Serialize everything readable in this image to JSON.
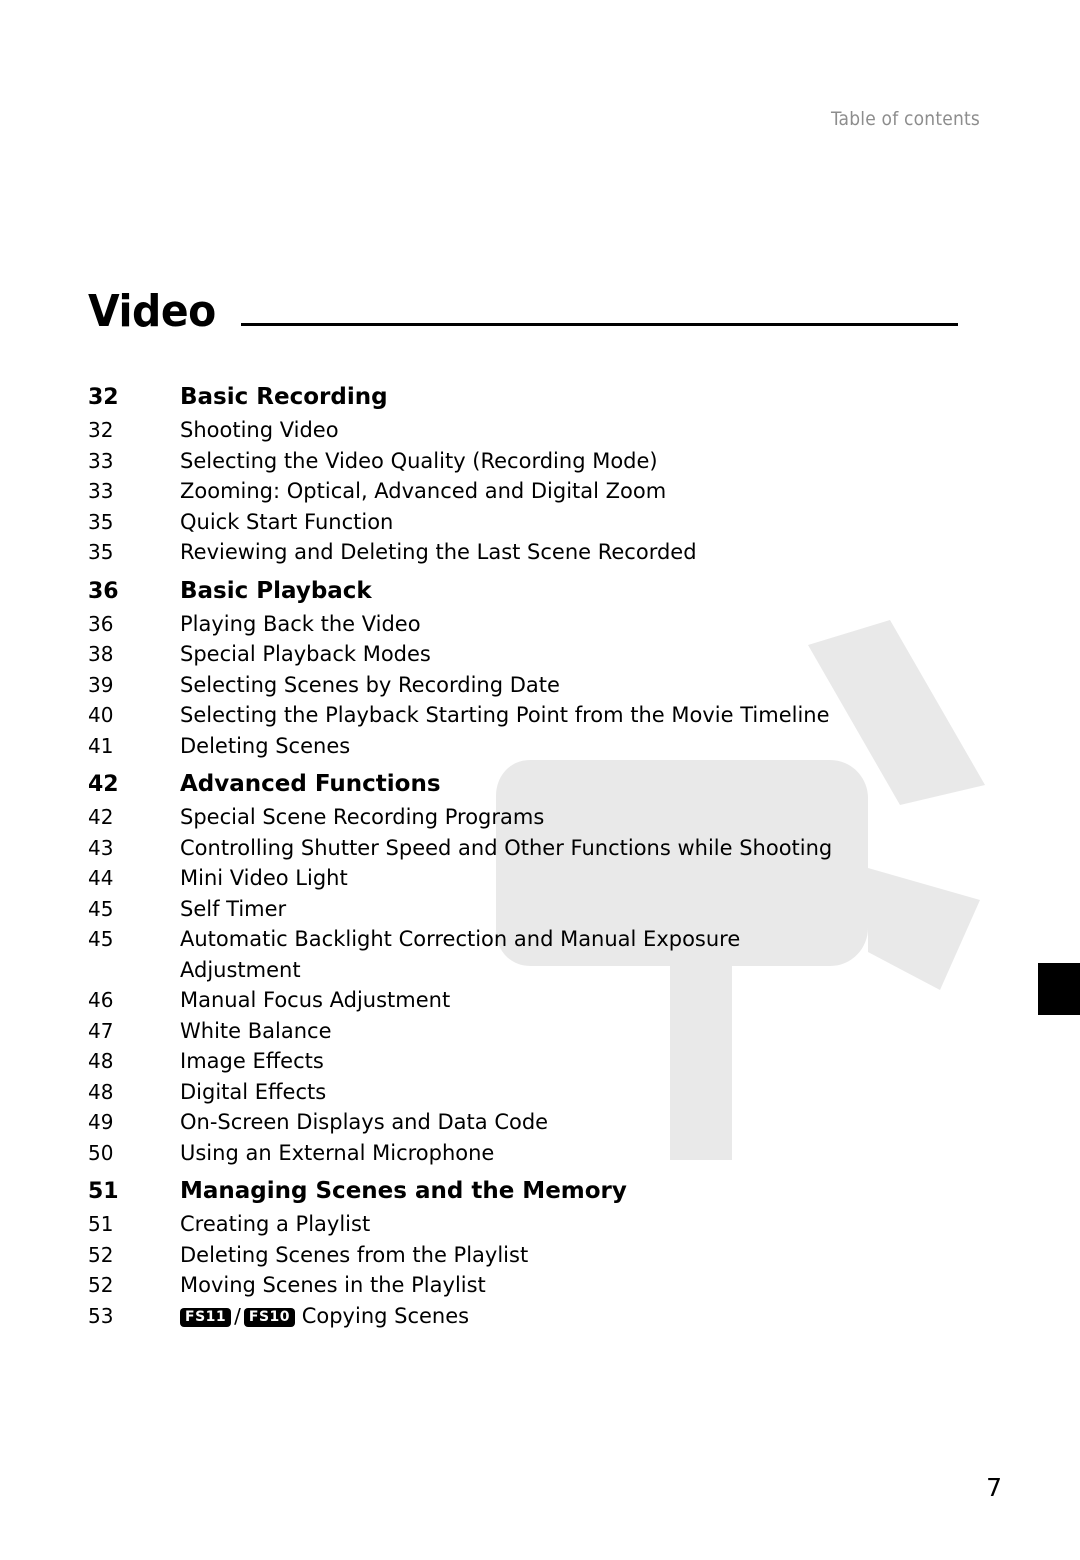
{
  "page": {
    "header_text": "Table of contents",
    "chapter_title": "Video",
    "folio": "7"
  },
  "sections": [
    {
      "page": "32",
      "title": "Basic Recording",
      "entries": [
        {
          "page": "32",
          "label": "Shooting Video"
        },
        {
          "page": "33",
          "label": "Selecting the Video Quality (Recording Mode)"
        },
        {
          "page": "33",
          "label": "Zooming: Optical, Advanced and Digital Zoom"
        },
        {
          "page": "35",
          "label": "Quick Start Function"
        },
        {
          "page": "35",
          "label": "Reviewing and Deleting the Last Scene Recorded"
        }
      ]
    },
    {
      "page": "36",
      "title": "Basic Playback",
      "entries": [
        {
          "page": "36",
          "label": "Playing Back the Video"
        },
        {
          "page": "38",
          "label": "Special Playback Modes"
        },
        {
          "page": "39",
          "label": "Selecting Scenes by Recording Date"
        },
        {
          "page": "40",
          "label": "Selecting the Playback Starting Point from the Movie Timeline"
        },
        {
          "page": "41",
          "label": "Deleting Scenes"
        }
      ]
    },
    {
      "page": "42",
      "title": "Advanced Functions",
      "entries": [
        {
          "page": "42",
          "label": "Special Scene Recording Programs"
        },
        {
          "page": "43",
          "label": "Controlling Shutter Speed and Other Functions while Shooting"
        },
        {
          "page": "44",
          "label": "Mini Video Light"
        },
        {
          "page": "45",
          "label": "Self Timer"
        },
        {
          "page": "45",
          "label": "Automatic Backlight Correction and Manual Exposure"
        },
        {
          "page": "",
          "label": "Adjustment"
        },
        {
          "page": "46",
          "label": "Manual Focus Adjustment"
        },
        {
          "page": "47",
          "label": "White Balance"
        },
        {
          "page": "48",
          "label": "Image Effects"
        },
        {
          "page": "48",
          "label": "Digital Effects"
        },
        {
          "page": "49",
          "label": "On-Screen Displays and Data Code"
        },
        {
          "page": "50",
          "label": "Using an External Microphone"
        }
      ]
    },
    {
      "page": "51",
      "title": "Managing Scenes and the Memory",
      "entries": [
        {
          "page": "51",
          "label": "Creating a Playlist"
        },
        {
          "page": "52",
          "label": "Deleting Scenes from the Playlist"
        },
        {
          "page": "52",
          "label": "Moving Scenes in the Playlist"
        }
      ]
    }
  ],
  "badged_entry": {
    "page": "53",
    "badge_1": "FS11",
    "separator": "/",
    "badge_2": "FS10",
    "label": "Copying Scenes"
  },
  "colors": {
    "header_gray": "#8d8d8d",
    "watermark_gray": "#e8e8e8",
    "text": "#000000",
    "tab_black": "#000000"
  }
}
